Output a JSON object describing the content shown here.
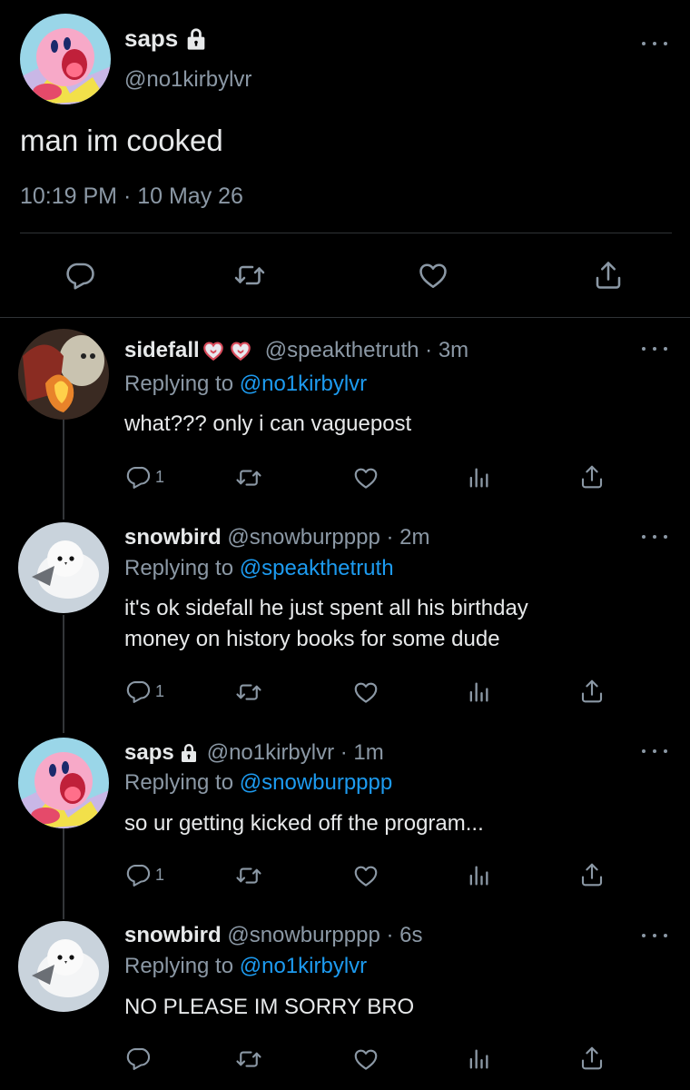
{
  "main_tweet": {
    "display_name": "saps",
    "handle": "@no1kirbylvr",
    "text": "man im cooked",
    "timestamp": "10:19 PM · 10 May 26"
  },
  "replies": [
    {
      "display_name": "sidefall",
      "meta": "@speakthetruth · 3m",
      "replying_prefix": "Replying to",
      "replying_to": "@no1kirbylvr",
      "text_lines": [
        "what??? only i can vaguepost"
      ],
      "reply_count": "1"
    },
    {
      "display_name": "snowbird",
      "meta": "@snowburpppp · 2m",
      "replying_prefix": "Replying to",
      "replying_to": "@speakthetruth",
      "text_lines": [
        "it's ok sidefall he just spent all his birthday",
        "money on history books for some dude"
      ],
      "reply_count": "1"
    },
    {
      "display_name": "saps",
      "meta": "@no1kirbylvr · 1m",
      "replying_prefix": "Replying to",
      "replying_to": "@snowburpppp",
      "text_lines": [
        "so ur getting kicked off the program..."
      ],
      "reply_count": "1"
    },
    {
      "display_name": "snowbird",
      "meta": "@snowburpppp · 6s",
      "replying_prefix": "Replying to",
      "replying_to": "@no1kirbylvr",
      "text_lines": [
        "NO PLEASE IM SORRY BRO"
      ],
      "reply_count": ""
    }
  ],
  "icons": {
    "reply": "reply-icon",
    "retweet": "retweet-icon",
    "like": "heart-icon",
    "analytics": "analytics-icon",
    "share": "share-icon",
    "more": "more-icon",
    "lock": "lock-icon"
  },
  "colors": {
    "background": "#000000",
    "text": "#e7e9ea",
    "secondary": "#8b98a5",
    "link": "#1d9bf0",
    "divider": "#2f3336"
  }
}
